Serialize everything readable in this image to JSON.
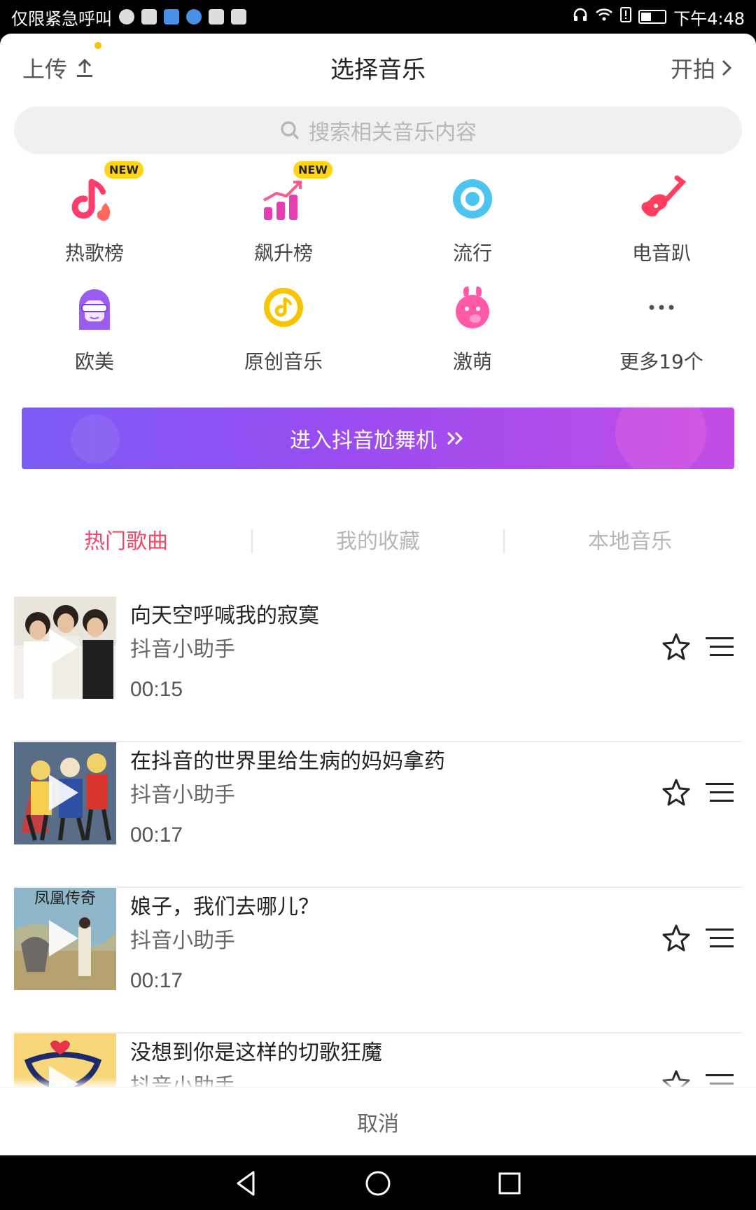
{
  "status_bar": {
    "left_text": "仅限紧急呼叫",
    "time": "下午4:48"
  },
  "header": {
    "upload_label": "上传",
    "title": "选择音乐",
    "shoot_label": "开拍"
  },
  "search": {
    "placeholder": "搜索相关音乐内容"
  },
  "categories": [
    {
      "label": "热歌榜",
      "badge": "NEW",
      "icon": "hot-songs-icon"
    },
    {
      "label": "飙升榜",
      "badge": "NEW",
      "icon": "rising-chart-icon"
    },
    {
      "label": "流行",
      "icon": "pop-disc-icon"
    },
    {
      "label": "电音趴",
      "icon": "electric-guitar-icon"
    },
    {
      "label": "欧美",
      "icon": "western-avatar-icon"
    },
    {
      "label": "原创音乐",
      "icon": "original-music-icon"
    },
    {
      "label": "激萌",
      "icon": "cute-pet-icon"
    },
    {
      "label": "更多19个",
      "icon": "more-dots-icon"
    }
  ],
  "banner": {
    "label": "进入抖音尬舞机"
  },
  "tabs": [
    {
      "label": "热门歌曲",
      "active": true
    },
    {
      "label": "我的收藏",
      "active": false
    },
    {
      "label": "本地音乐",
      "active": false
    }
  ],
  "songs": [
    {
      "title": "向天空呼喊我的寂寞",
      "artist": "抖音小助手",
      "duration": "00:15"
    },
    {
      "title": "在抖音的世界里给生病的妈妈拿药",
      "artist": "抖音小助手",
      "duration": "00:17"
    },
    {
      "title": "娘子，我们去哪儿？",
      "artist": "抖音小助手",
      "duration": "00:17"
    },
    {
      "title": "没想到你是这样的切歌狂魔",
      "artist": "抖音小助手",
      "duration": ""
    }
  ],
  "cover_texts": {
    "song3_cover_title": "凤凰传奇"
  },
  "cancel_label": "取消",
  "colors": {
    "accent_active_tab": "#f0466b",
    "banner_gradient_start": "#7c5cf5",
    "banner_gradient_end": "#c24de6",
    "badge": "#ffd51a"
  }
}
